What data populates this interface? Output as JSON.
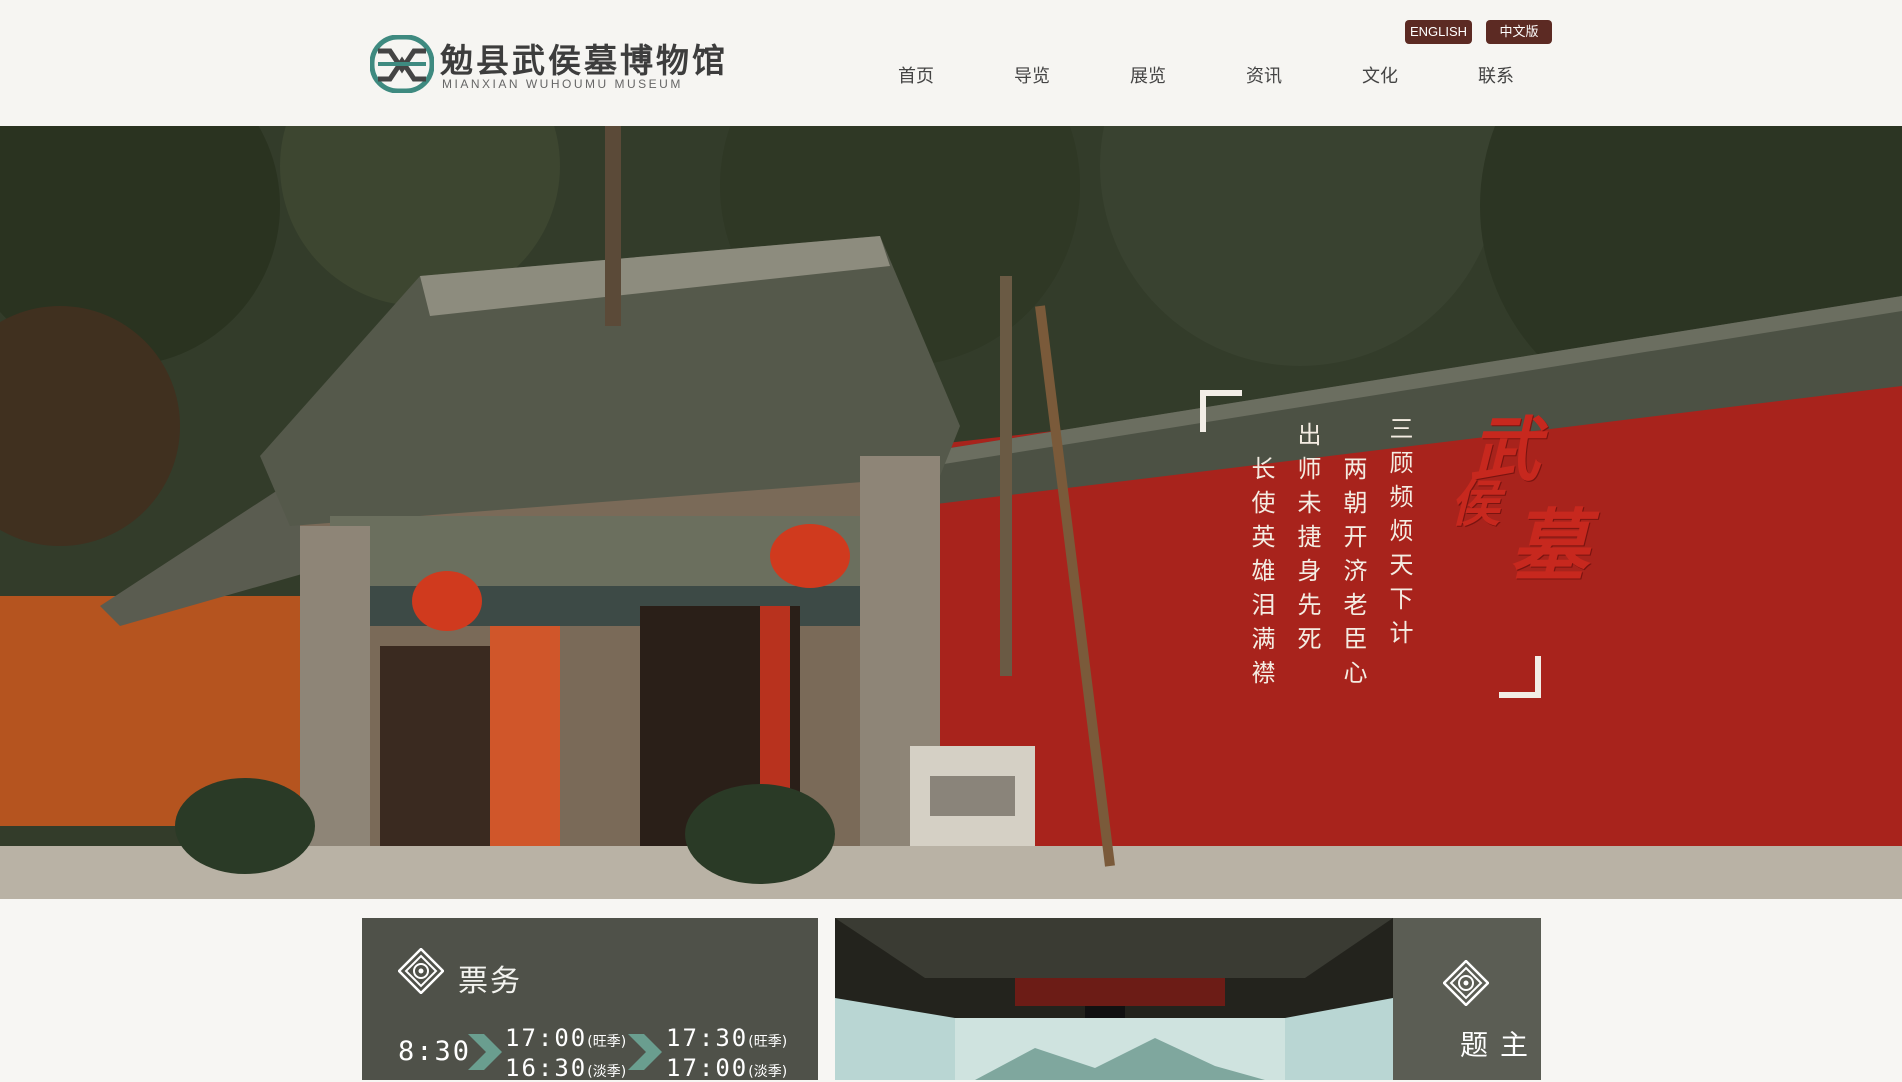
{
  "header": {
    "logo_cn": "勉县武侯墓博物馆",
    "logo_en": "MIANXIAN WUHOUMU MUSEUM",
    "lang_en": "ENGLISH",
    "lang_cn": "中文版",
    "nav": [
      "首页",
      "导览",
      "展览",
      "资讯",
      "文化",
      "联系"
    ]
  },
  "hero": {
    "calligraphy": [
      "武",
      "侯",
      "墓"
    ],
    "poem": [
      "三顾频烦天下计",
      "两朝开济老臣心",
      "出师未捷身先死",
      "长使英雄泪满襟"
    ]
  },
  "ticket": {
    "title": "票务",
    "open_time": "8:30",
    "close_peak": "17:00",
    "close_off": "16:30",
    "last_peak": "17:30",
    "last_off": "17:00",
    "peak_label": "(旺季)",
    "off_label": "(淡季)"
  },
  "theme": {
    "title": "主题"
  },
  "colors": {
    "brand_dark": "#5c2a23",
    "card_bg": "#4f5149",
    "wall_red": "#a8231c",
    "accent_teal": "#3e8a80"
  }
}
